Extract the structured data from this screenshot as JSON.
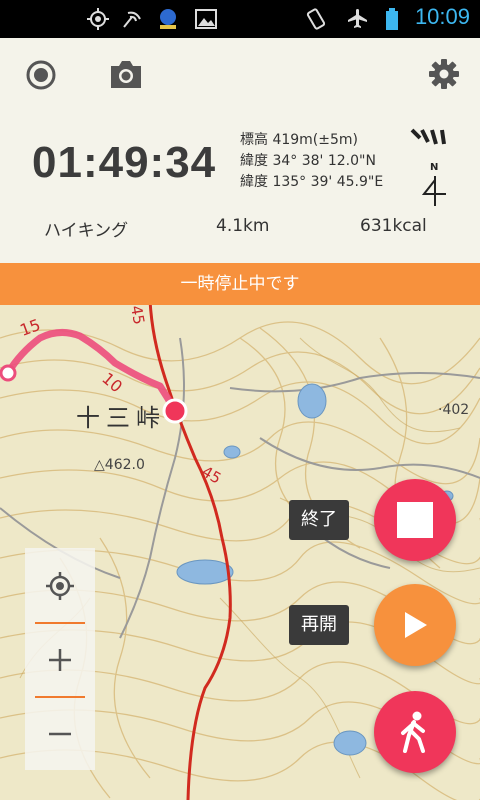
{
  "status_bar": {
    "time": "10:09",
    "icons": [
      "gps-icon",
      "signal-icon",
      "app-icon",
      "image-icon",
      "rotate-icon",
      "airplane-mode-icon",
      "battery-icon"
    ]
  },
  "toolbar": {
    "icons": [
      "record-icon",
      "camera-icon",
      "settings-icon"
    ]
  },
  "tracking": {
    "elapsed_time": "01:49:34",
    "altitude": "標高 419m(±5m)",
    "latitude": "緯度 34° 38' 12.0\"N",
    "longitude": "緯度 135° 39' 45.9\"E",
    "activity": "ハイキング",
    "distance": "4.1km",
    "calories": "631kcal",
    "compass_label": "N"
  },
  "banner": {
    "text": "一時停止中です"
  },
  "map": {
    "place_name": "十三峠",
    "spot_height": "462.0",
    "spot_height_east": "402",
    "route_labels": [
      "15",
      "10",
      "45",
      "45"
    ]
  },
  "actions": {
    "stop_label": "終了",
    "resume_label": "再開"
  },
  "colors": {
    "accent_orange": "#f7913d",
    "action_red": "#f0365a",
    "route_pink": "#ec4d7c",
    "road_red": "#d12a1f",
    "clock_blue": "#3db7f0"
  }
}
